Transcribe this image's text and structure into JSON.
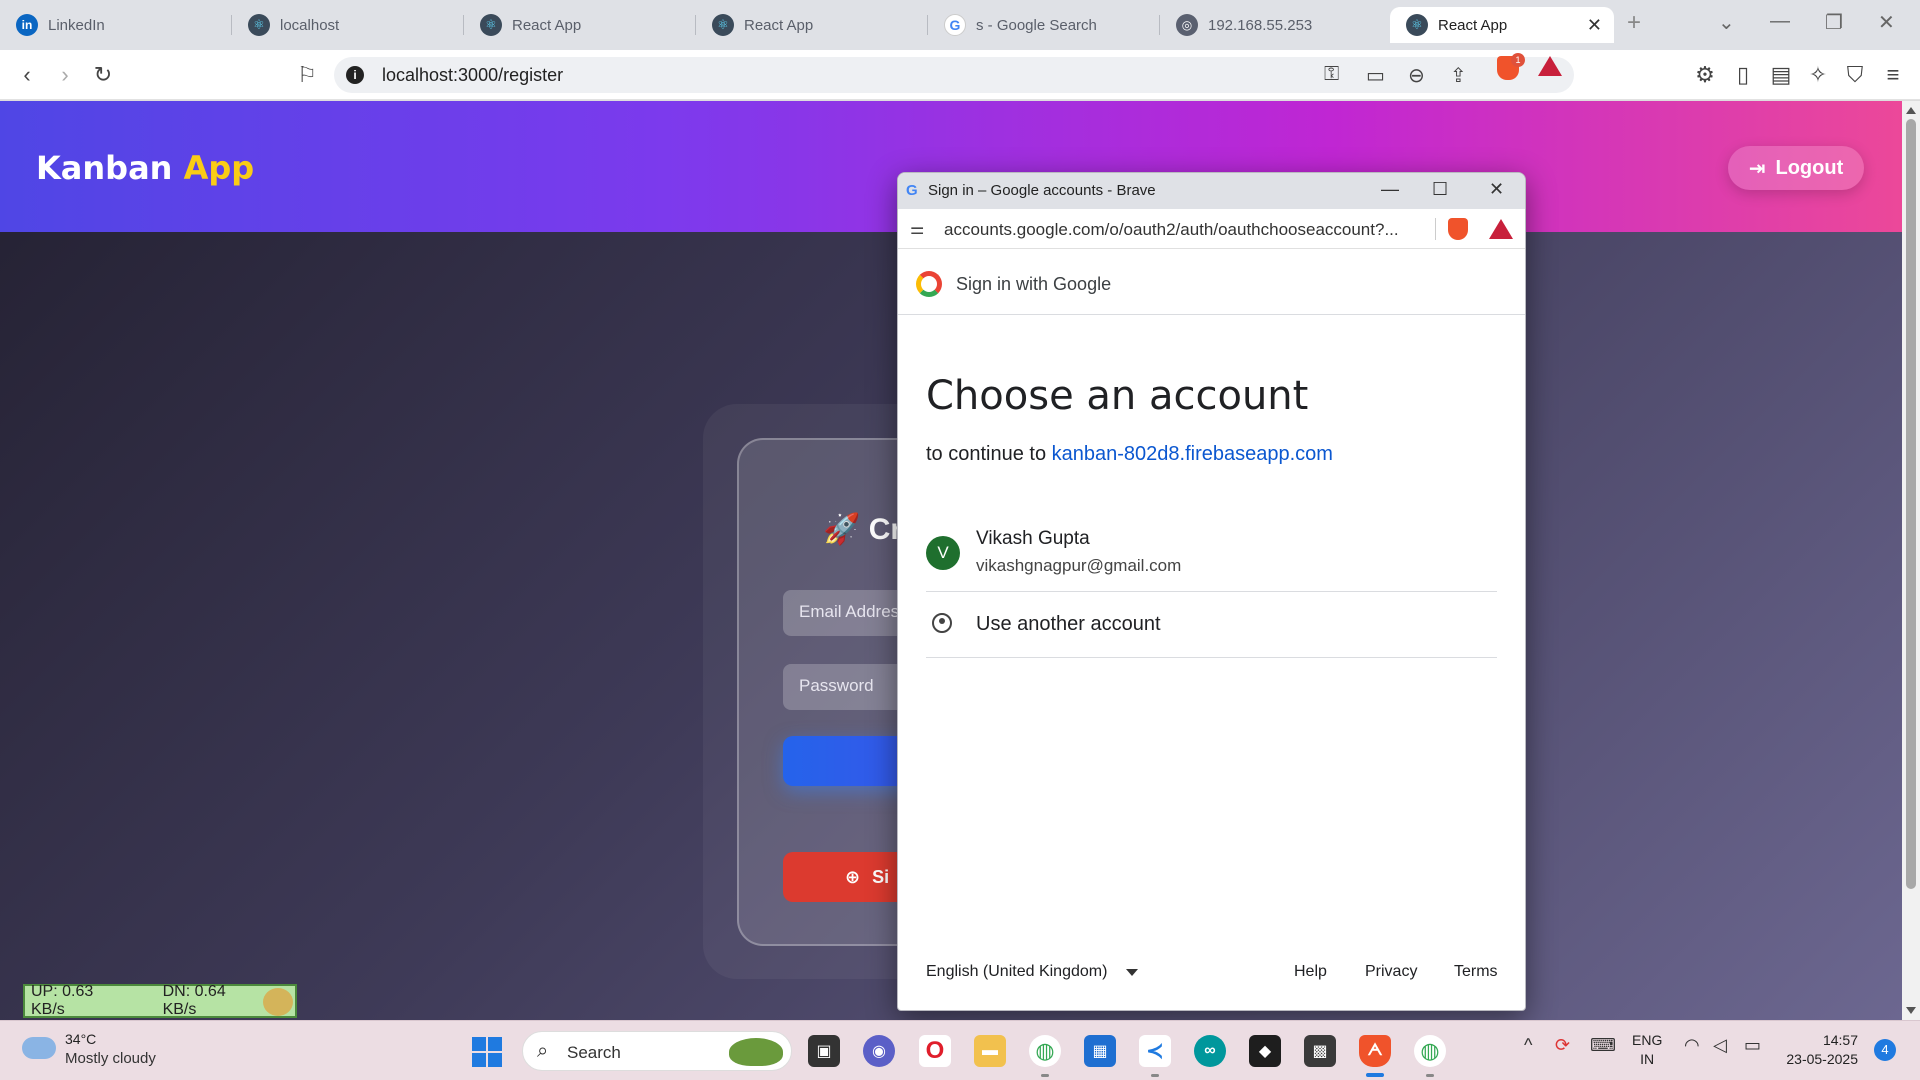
{
  "browser": {
    "tabs": [
      {
        "title": "LinkedIn",
        "icon": "linkedin-icon"
      },
      {
        "title": "localhost",
        "icon": "react-icon"
      },
      {
        "title": "React App",
        "icon": "react-icon"
      },
      {
        "title": "React App",
        "icon": "react-icon"
      },
      {
        "title": "s - Google Search",
        "icon": "google-icon"
      },
      {
        "title": "192.168.55.253",
        "icon": "globe-icon"
      },
      {
        "title": "React App",
        "icon": "react-icon",
        "active": true
      }
    ],
    "url": "localhost:3000/register",
    "shield_badge": "1"
  },
  "app": {
    "brand_main": "Kanban",
    "brand_accent": "App",
    "logout_label": "Logout",
    "card_title": "Cr",
    "email_placeholder": "Email Addres",
    "password_placeholder": "Password",
    "google_button_label": "Si"
  },
  "network_monitor": {
    "up": "UP: 0.63 KB/s",
    "down": "DN: 0.64 KB/s"
  },
  "popup": {
    "window_title": "Sign in – Google accounts - Brave",
    "url": "accounts.google.com/o/oauth2/auth/oauthchooseaccount?...",
    "header": "Sign in with Google",
    "heading": "Choose an account",
    "continue_prefix": "to continue to",
    "continue_domain": "kanban-802d8.firebaseapp.com",
    "account": {
      "initial": "V",
      "name": "Vikash Gupta",
      "email": "vikashgnagpur@gmail.com"
    },
    "use_another": "Use another account",
    "footer": {
      "language": "English (United Kingdom)",
      "help": "Help",
      "privacy": "Privacy",
      "terms": "Terms"
    }
  },
  "taskbar": {
    "weather_temp": "34°C",
    "weather_cond": "Mostly cloudy",
    "search_label": "Search",
    "lang_line1": "ENG",
    "lang_line2": "IN",
    "time": "14:57",
    "date": "23-05-2025",
    "notification_count": "4"
  },
  "colors": {
    "navbar_gradient": [
      "#4f46e5",
      "#7c3aed",
      "#c026d3",
      "#ec4899"
    ],
    "brand_accent": "#facc15",
    "google_button": "#dc3a2f",
    "link": "#0b57d0",
    "avatar": "#1f6f2e"
  }
}
